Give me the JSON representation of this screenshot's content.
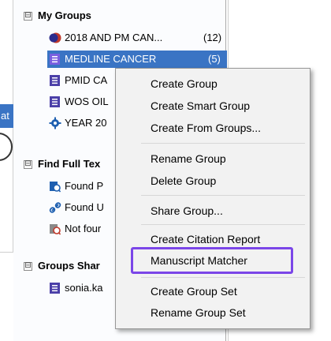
{
  "left_window": {
    "strip_text": "at"
  },
  "tree": {
    "my_groups": {
      "label": "My Groups",
      "expander": "⊟",
      "items": [
        {
          "label": "2018 AND PM CAN...",
          "count": "(12)",
          "icon": "smart-group-icon"
        },
        {
          "label": "MEDLINE CANCER",
          "count": "(5)",
          "icon": "group-icon",
          "selected": true
        },
        {
          "label": "PMID CA",
          "icon": "group-icon"
        },
        {
          "label": "WOS OIL",
          "icon": "group-icon"
        },
        {
          "label": "YEAR 20",
          "icon": "gear-group-icon"
        }
      ]
    },
    "find_full_text": {
      "label": "Find Full Tex",
      "expander": "⊟",
      "items": [
        {
          "label": "Found P",
          "icon": "found-pdf-icon"
        },
        {
          "label": "Found U",
          "icon": "found-url-icon"
        },
        {
          "label": "Not four",
          "icon": "not-found-icon"
        }
      ]
    },
    "groups_shared": {
      "label": "Groups Shar",
      "expander": "⊟",
      "items": [
        {
          "label": "sonia.ka",
          "icon": "group-icon"
        }
      ]
    }
  },
  "context_menu": {
    "items": [
      "Create Group",
      "Create Smart Group",
      "Create From Groups...",
      "Rename Group",
      "Delete Group",
      "Share Group...",
      "Create Citation Report",
      "Manuscript Matcher",
      "Create Group Set",
      "Rename Group Set"
    ],
    "highlighted_item": "Manuscript Matcher"
  },
  "colors": {
    "selection": "#3a74c4",
    "highlight_border": "#7b46e8",
    "group_icon": "#4b3fa8",
    "smart_group_red": "#c0392b",
    "link_blue": "#1e5fb0"
  }
}
